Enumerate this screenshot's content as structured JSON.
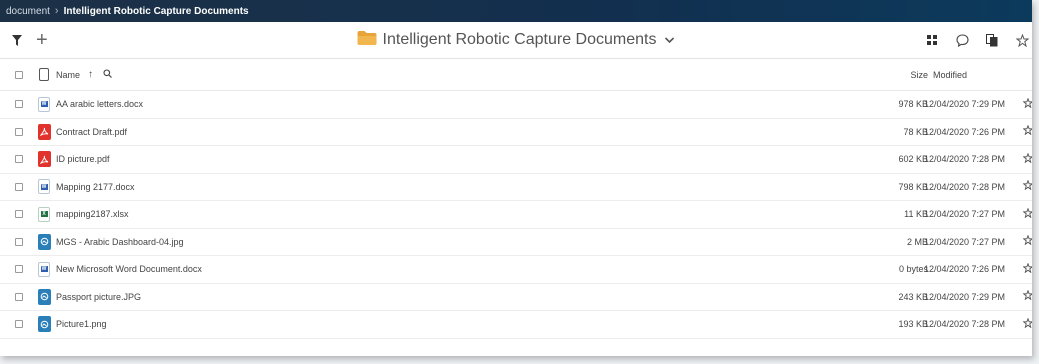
{
  "breadcrumb": {
    "root": "document",
    "separator": "›",
    "current": "Intelligent Robotic Capture Documents"
  },
  "toolbar": {
    "filter_icon": "filter-icon",
    "add_symbol": "+",
    "folder_title": "Intelligent Robotic Capture Documents",
    "folder_icon": "folder-icon",
    "chevron": "⌄",
    "right_icons": [
      "grid-view-icon",
      "comment-icon",
      "copy-icon",
      "star-icon"
    ]
  },
  "columns": {
    "name": "Name",
    "sort_arrow": "↑",
    "size": "Size",
    "modified": "Modified"
  },
  "files": [
    {
      "name": "AA arabic letters.docx",
      "type": "word",
      "badge": "W",
      "size": "978 KB",
      "modified": "12/04/2020 7:29 PM"
    },
    {
      "name": "Contract Draft.pdf",
      "type": "pdf",
      "badge": "",
      "size": "78 KB",
      "modified": "12/04/2020 7:26 PM"
    },
    {
      "name": "ID picture.pdf",
      "type": "pdf",
      "badge": "",
      "size": "602 KB",
      "modified": "12/04/2020 7:28 PM"
    },
    {
      "name": "Mapping 2177.docx",
      "type": "word",
      "badge": "W",
      "size": "798 KB",
      "modified": "12/04/2020 7:28 PM"
    },
    {
      "name": "mapping2187.xlsx",
      "type": "excel",
      "badge": "X",
      "size": "11 KB",
      "modified": "12/04/2020 7:27 PM"
    },
    {
      "name": "MGS - Arabic Dashboard-04.jpg",
      "type": "img",
      "badge": "",
      "size": "2 MB",
      "modified": "12/04/2020 7:27 PM"
    },
    {
      "name": "New Microsoft Word Document.docx",
      "type": "word",
      "badge": "W",
      "size": "0 bytes",
      "modified": "12/04/2020 7:26 PM"
    },
    {
      "name": "Passport picture.JPG",
      "type": "img",
      "badge": "",
      "size": "243 KB",
      "modified": "12/04/2020 7:29 PM"
    },
    {
      "name": "Picture1.png",
      "type": "img",
      "badge": "",
      "size": "193 KB",
      "modified": "12/04/2020 7:28 PM"
    }
  ],
  "colors": {
    "topbar": "#122f4f",
    "folder": "#e8a33b",
    "pdf": "#e2322c",
    "image": "#2b7fb8",
    "word": "#2f5eb0",
    "excel": "#217346"
  }
}
